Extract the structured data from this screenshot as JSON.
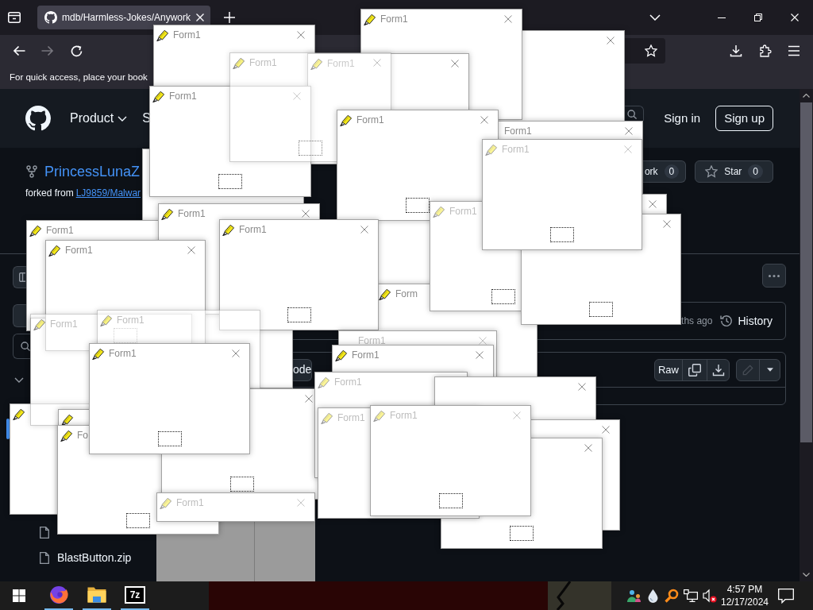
{
  "browser": {
    "tabs": [
      {
        "title": "mdb/Harmless-Jokes/Anywork",
        "selected": true
      }
    ],
    "nav": [
      {
        "kind": "back",
        "disabled": false
      },
      {
        "kind": "forward",
        "disabled": true
      },
      {
        "kind": "reload",
        "disabled": false
      }
    ],
    "bookmarks_hint": "For quick access, place your book"
  },
  "github": {
    "nav": [
      {
        "label": "Product",
        "kind": "menu"
      },
      {
        "label": "S",
        "kind": "link"
      }
    ],
    "sign_in": "Sign in",
    "sign_up": "Sign up",
    "repo": {
      "name": "PrincessLunaZ",
      "forked_from": "forked from",
      "source": "LJ9859/Malwar"
    },
    "repo_buttons": [
      {
        "kind": "fork",
        "label": "ork",
        "count": "0"
      },
      {
        "kind": "star",
        "label": "Star",
        "count": "0"
      }
    ],
    "tree": [
      {
        "selected": true
      },
      {
        "kind": "file",
        "selected": false
      },
      {
        "kind": "file",
        "name": "BlastButton.zip",
        "selected": false
      }
    ],
    "last_commit": "ths ago",
    "history": "History",
    "code_button": "ode",
    "file_actions": [
      {
        "kind": "raw",
        "label": "Raw",
        "disabled": false
      },
      {
        "kind": "copy",
        "disabled": false
      },
      {
        "kind": "download",
        "disabled": false
      },
      {
        "kind": "edit",
        "disabled": true
      },
      {
        "kind": "menu",
        "disabled": false
      }
    ]
  },
  "forms": [
    {
      "kind": "solid"
    },
    {
      "kind": "solid",
      "title": "Form1"
    },
    {
      "kind": "solid",
      "title": "Form1"
    },
    {
      "kind": "solid",
      "title": "Form1"
    },
    {
      "kind": "solid"
    },
    {
      "kind": "solid",
      "title": "Form1"
    },
    {
      "kind": "faded",
      "title": "Form1"
    },
    {
      "kind": "solid",
      "title": "Form1"
    },
    {
      "kind": "solid"
    },
    {
      "kind": "solid",
      "title": "Form1"
    },
    {
      "kind": "solid",
      "title": "Form"
    },
    {
      "kind": "solid"
    },
    {
      "kind": "dim",
      "title": "Form1"
    },
    {
      "kind": "solid"
    },
    {
      "kind": "dim",
      "title": "Form1"
    },
    {
      "kind": "solid"
    },
    {
      "kind": "solid",
      "title": "Form1"
    },
    {
      "kind": "solid",
      "title": "Form1"
    },
    {
      "kind": "solid",
      "title": "Form1"
    },
    {
      "kind": "solid"
    },
    {
      "kind": "solid",
      "title": "Form1"
    },
    {
      "kind": "solid"
    },
    {
      "kind": "faded",
      "title": "Form1"
    },
    {
      "kind": "faded",
      "title": "Form1"
    },
    {
      "kind": "solid"
    },
    {
      "kind": "solid",
      "title": "Fo"
    },
    {
      "kind": "solid"
    },
    {
      "kind": "solid",
      "title": "Form1"
    },
    {
      "kind": "dim",
      "title": "Form1"
    },
    {
      "kind": "dim",
      "title": "Form1"
    },
    {
      "kind": "solid",
      "title": "Form1"
    },
    {
      "kind": "dim",
      "title": "Form1"
    },
    {
      "kind": "solid"
    },
    {
      "kind": "solid"
    },
    {
      "kind": "solid"
    },
    {
      "kind": "dim",
      "title": "Form1"
    },
    {
      "kind": "dim",
      "title": "Form1"
    }
  ],
  "taskbar": {
    "apps": [
      {
        "kind": "browser",
        "open": true
      },
      {
        "kind": "folder",
        "open": true
      },
      {
        "kind": "archiver",
        "label": "7z",
        "open": true
      }
    ],
    "volume": {
      "muted": true
    },
    "time": "4:57 PM",
    "date": "12/17/2024"
  }
}
